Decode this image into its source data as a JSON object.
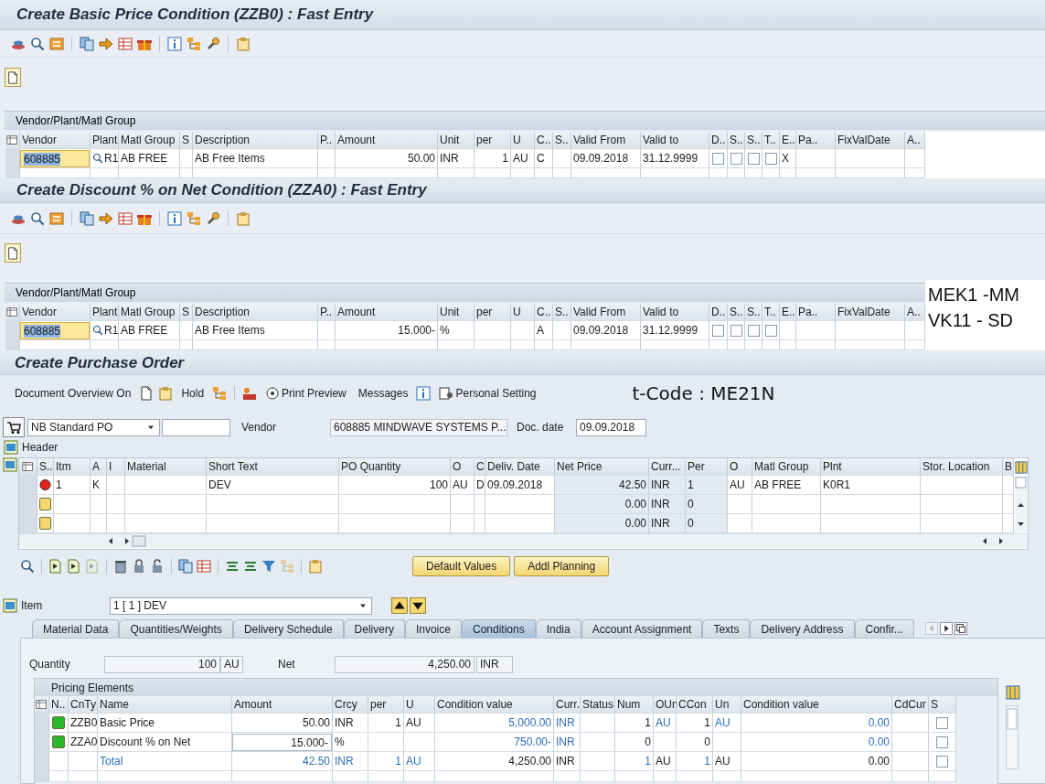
{
  "condition_screens": [
    {
      "title": "Create Basic Price Condition (ZZB0) : Fast Entry",
      "group": "Vendor/Plant/Matl Group",
      "table": {
        "columns": [
          "Vendor",
          "Plant",
          "Matl Group",
          "S",
          "Description",
          "P..",
          "Amount",
          "Unit",
          "per",
          "U",
          "C..",
          "S..",
          "Valid From",
          "Valid to",
          "D..",
          "S..",
          "S..",
          "T..",
          "E..",
          "Pa..",
          "FixValDate",
          "A.."
        ],
        "rows": [
          [
            {
              "kind": "input",
              "text": "608885",
              "focused": true
            },
            {
              "kind": "search",
              "text": "R1"
            },
            "AB FREE",
            "",
            "AB Free Items",
            "",
            "50.00",
            "INR",
            "1",
            "AU",
            "C",
            "",
            "09.09.2018",
            "31.12.9999",
            {
              "kind": "checkbox",
              "checked": false
            },
            {
              "kind": "checkbox",
              "checked": false
            },
            {
              "kind": "checkbox",
              "checked": false
            },
            {
              "kind": "checkbox",
              "checked": false
            },
            "X",
            "",
            "",
            ""
          ]
        ]
      }
    },
    {
      "title": "Create Discount % on Net Condition (ZZA0) : Fast Entry",
      "group": "Vendor/Plant/Matl Group",
      "table": {
        "columns": [
          "Vendor",
          "Plant",
          "Matl Group",
          "S",
          "Description",
          "P..",
          "Amount",
          "Unit",
          "per",
          "U",
          "C..",
          "S..",
          "Valid From",
          "Valid to",
          "D..",
          "S..",
          "S..",
          "T..",
          "E..",
          "Pa..",
          "FixValDate",
          "A.."
        ],
        "rows": [
          [
            {
              "kind": "input",
              "text": "608885",
              "focused": true
            },
            {
              "kind": "search",
              "text": "R1"
            },
            "AB FREE",
            "",
            "AB Free Items",
            "",
            "15.000-",
            "%",
            "",
            "",
            "A",
            "",
            "09.09.2018",
            "31.12.9999",
            {
              "kind": "checkbox",
              "checked": false
            },
            {
              "kind": "checkbox",
              "checked": false
            },
            {
              "kind": "checkbox",
              "checked": false
            },
            {
              "kind": "checkbox",
              "checked": false
            },
            "",
            "",
            "",
            ""
          ]
        ]
      }
    }
  ],
  "annotations": [
    "MEK1 -MM",
    "VK11 - SD"
  ],
  "purchase_order": {
    "title": "Create Purchase Order",
    "toolbar": [
      "Document Overview On",
      "Hold",
      "Print Preview",
      "Messages",
      "Personal Setting"
    ],
    "tcode": "t-Code : ME21N",
    "header": {
      "order_type": "NB Standard PO",
      "vendor_label": "Vendor",
      "vendor": "608885 MINDWAVE SYSTEMS P...",
      "date_label": "Doc. date",
      "doc_date": "09.09.2018"
    },
    "header_section": "Header",
    "items": {
      "columns": [
        "S..",
        "Itm",
        "A",
        "I",
        "Material",
        "Short Text",
        "PO Quantity",
        "O",
        "C",
        "Deliv. Date",
        "Net Price",
        "Curr...",
        "Per",
        "O",
        "Matl Group",
        "Plnt",
        "Stor. Location",
        "B"
      ],
      "rows": [
        [
          {
            "kind": "light",
            "color": "#e3261c"
          },
          "1",
          "K",
          "",
          "",
          "DEV",
          "100",
          "AU",
          "D",
          "09.09.2018",
          "42.50",
          "INR",
          "1",
          "AU",
          "AB FREE",
          "K0R1",
          "",
          ""
        ],
        [
          {
            "kind": "square",
            "color": "#f6d66e"
          },
          "",
          "",
          "",
          "",
          "",
          "",
          "",
          "",
          "",
          "0.00",
          "INR",
          "0",
          "",
          "",
          "",
          "",
          ""
        ],
        [
          {
            "kind": "square",
            "color": "#f6d66e"
          },
          "",
          "",
          "",
          "",
          "",
          "",
          "",
          "",
          "",
          "0.00",
          "INR",
          "0",
          "",
          "",
          "",
          "",
          ""
        ]
      ]
    },
    "item_buttons": [
      "Default Values",
      "Addl Planning"
    ],
    "item_detail": {
      "label": "Item",
      "selector": "1 [ 1 ] DEV"
    },
    "tabs": [
      {
        "label": "Material Data",
        "selected": false
      },
      {
        "label": "Quantities/Weights",
        "selected": false
      },
      {
        "label": "Delivery Schedule",
        "selected": false
      },
      {
        "label": "Delivery",
        "selected": false
      },
      {
        "label": "Invoice",
        "selected": false
      },
      {
        "label": "Conditions",
        "selected": true
      },
      {
        "label": "India",
        "selected": false
      },
      {
        "label": "Account Assignment",
        "selected": false
      },
      {
        "label": "Texts",
        "selected": false
      },
      {
        "label": "Delivery Address",
        "selected": false
      },
      {
        "label": "Confir...",
        "selected": false
      }
    ],
    "conditions": {
      "quantity_label": "Quantity",
      "quantity": "100",
      "quantity_unit": "AU",
      "net_label": "Net",
      "net": "4,250.00",
      "net_currency": "INR",
      "group": "Pricing Elements",
      "pricing": {
        "columns": [
          "N..",
          "CnTy",
          "Name",
          "Amount",
          "Crcy",
          "per",
          "U",
          "Condition value",
          "Curr.",
          "Status",
          "Num",
          "OUn",
          "CCon",
          "Un",
          "Condition value",
          "CdCur",
          "S"
        ],
        "rows": [
          [
            {
              "kind": "square",
              "color": "#2db52d"
            },
            "ZZB0",
            "Basic Price",
            "50.00",
            "INR",
            "1",
            "AU",
            {
              "kind": "text",
              "text": "5,000.00",
              "color": "#2a6ebb"
            },
            {
              "kind": "text",
              "text": "INR",
              "color": "#2a6ebb"
            },
            "",
            "1",
            {
              "kind": "text",
              "text": "AU",
              "color": "#2a6ebb"
            },
            "1",
            {
              "kind": "text",
              "text": "AU",
              "color": "#2a6ebb"
            },
            {
              "kind": "text",
              "text": "0.00",
              "color": "#2a6ebb"
            },
            "",
            {
              "kind": "checkbox",
              "checked": false
            }
          ],
          [
            {
              "kind": "square",
              "color": "#2db52d"
            },
            "ZZA0",
            "Discount % on Net",
            {
              "kind": "input",
              "text": "15.000-",
              "focused": false
            },
            "%",
            "",
            "",
            {
              "kind": "text",
              "text": "750.00-",
              "color": "#2a6ebb"
            },
            {
              "kind": "text",
              "text": "INR",
              "color": "#2a6ebb"
            },
            "",
            "0",
            "",
            "0",
            "",
            {
              "kind": "text",
              "text": "0.00",
              "color": "#2a6ebb"
            },
            "",
            {
              "kind": "checkbox",
              "checked": false
            }
          ],
          [
            "",
            "",
            {
              "kind": "text",
              "text": "Total",
              "color": "#2a6ebb"
            },
            {
              "kind": "text",
              "text": "42.50",
              "color": "#2a6ebb"
            },
            {
              "kind": "text",
              "text": "INR",
              "color": "#2a6ebb"
            },
            {
              "kind": "text",
              "text": "1",
              "color": "#2a6ebb"
            },
            {
              "kind": "text",
              "text": "AU",
              "color": "#2a6ebb"
            },
            "4,250.00",
            "INR",
            "",
            {
              "kind": "text",
              "text": "1",
              "color": "#2a6ebb"
            },
            "AU",
            {
              "kind": "text",
              "text": "1",
              "color": "#2a6ebb"
            },
            "AU",
            "0.00",
            "",
            {
              "kind": "checkbox",
              "checked": false
            }
          ]
        ]
      }
    }
  }
}
